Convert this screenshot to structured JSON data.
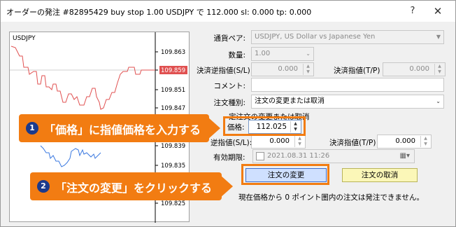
{
  "window": {
    "title": "オーダーの発注 #82895429 buy stop 1.00 USDJPY で 112.000 sl: 0.000 tp: 0.000",
    "help_label": "?",
    "close_label": "✕"
  },
  "chart": {
    "symbol": "USDJPY",
    "price_ticks": [
      "109.863",
      "109.859",
      "109.851",
      "109.847",
      "109.843",
      "109.839",
      "109.835",
      "109.829",
      "109.825"
    ],
    "current_price": "109.859"
  },
  "form": {
    "symbol_label": "通貨ペア:",
    "symbol_value": "USDJPY, US Dollar vs Japanese Yen",
    "volume_label": "数量:",
    "volume_value": "1.00",
    "sl_label": "決済逆指値(S/L)",
    "sl_value": "0.000",
    "tp_label": "決済指値(T/P)",
    "tp_value": "0.000",
    "comment_label": "コメント:",
    "comment_value": "",
    "order_type_label": "注文種別:",
    "order_type_value": "注文の変更または取消"
  },
  "modify_group": {
    "title": "定注文の変更または取消",
    "price_label": "価格:",
    "price_value": "112.025",
    "sl_label": "逆指値(S/L):",
    "sl_value": "0.000",
    "tp_label": "決済指値(T/P)",
    "tp_value": "0.000",
    "expiry_label": "有効期限:",
    "expiry_value": "2021.08.31 11:26",
    "modify_button": "注文の変更",
    "cancel_button": "注文の取消",
    "note": "現在価格から 0 ポイント圏内の注文は発注できません。"
  },
  "callouts": [
    {
      "number": "1",
      "text": "「価格」に指値価格を入力する"
    },
    {
      "number": "2",
      "text": "「注文の変更」をクリックする"
    }
  ],
  "colors": {
    "accent": "#f27c12",
    "badge": "#1b3a8c",
    "ask_line": "#e05050",
    "bid_line": "#3a78e0",
    "modify_button": "#cfe0ff",
    "cancel_button": "#fbf7b8"
  }
}
